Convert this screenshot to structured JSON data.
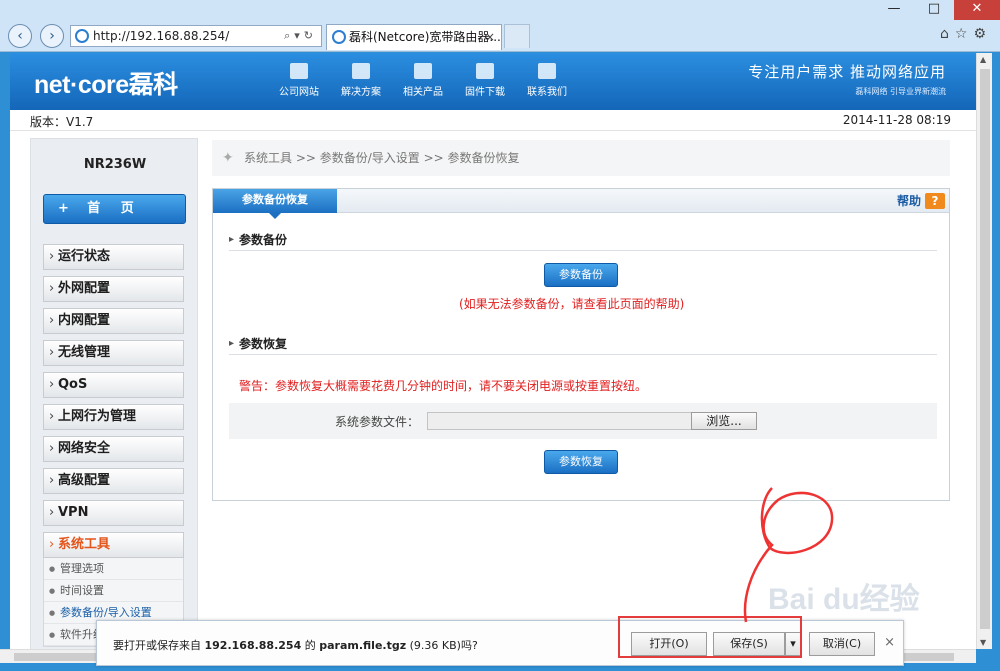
{
  "browser": {
    "url": "http://192.168.88.254/",
    "tab_title": "磊科(Netcore)宽带路由器...",
    "window_controls": [
      "—",
      "□",
      "✕"
    ]
  },
  "banner": {
    "logo": "net·core磊科",
    "nav": [
      "公司网站",
      "解决方案",
      "相关产品",
      "固件下载",
      "联系我们"
    ],
    "slogan": "专注用户需求  推动网络应用",
    "slogan_sub": "磊科网络 引导业界新潮流"
  },
  "info": {
    "version": "版本：V1.7",
    "datetime": "2014-11-28 08:19"
  },
  "sidebar": {
    "model": "NR236W",
    "home": "首  页",
    "items": [
      "运行状态",
      "外网配置",
      "内网配置",
      "无线管理",
      "QoS",
      "上网行为管理",
      "网络安全",
      "高级配置",
      "VPN",
      "系统工具"
    ],
    "sub_items": [
      "管理选项",
      "时间设置",
      "参数备份/导入设置",
      "软件升级"
    ]
  },
  "breadcrumb": "系统工具  >>  参数备份/导入设置  >>  参数备份恢复",
  "panel": {
    "tab": "参数备份恢复",
    "help": "帮助",
    "backup_title": "参数备份",
    "backup_btn": "参数备份",
    "backup_note": "(如果无法参数备份，请查看此页面的帮助)",
    "restore_title": "参数恢复",
    "warning": "警告：参数恢复大概需要花费几分钟的时间，请不要关闭电源或按重置按纽。",
    "file_label": "系统参数文件：",
    "browse": "浏览...",
    "restore_btn": "参数恢复"
  },
  "download": {
    "prefix": "要打开或保存来自 ",
    "host": "192.168.88.254",
    "mid": " 的 ",
    "file": "param.file.tgz",
    "suffix": " (9.36 KB)吗?",
    "open": "打开(O)",
    "save": "保存(S)",
    "cancel": "取消(C)"
  },
  "colors": {
    "accent": "#1a6fc3",
    "warning": "#e02020",
    "active_menu": "#e4541b"
  }
}
